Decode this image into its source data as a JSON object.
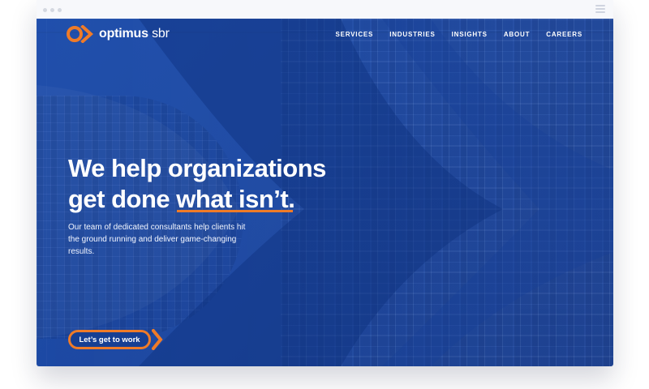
{
  "browser": {
    "menu_icon": "hamburger-menu-icon",
    "window_dots_icon": "window-dots-icon"
  },
  "brand": {
    "name_bold": "optimus",
    "name_regular": " sbr",
    "logo_icon": "optimus-logo-icon",
    "accent_color": "#ef7b28"
  },
  "nav": {
    "items": [
      {
        "label": "SERVICES"
      },
      {
        "label": "INDUSTRIES"
      },
      {
        "label": "INSIGHTS"
      },
      {
        "label": "ABOUT"
      },
      {
        "label": "CAREERS"
      }
    ]
  },
  "hero": {
    "headline_line_1": "We help organizations",
    "headline_line_2_prefix": "get done ",
    "headline_highlight": "what isn’t.",
    "description": "Our team of dedicated consultants help clients hit the ground running and deliver game-changing results.",
    "cta_label": "Let’s get to work",
    "cta_arrow_icon": "chevron-right-icon"
  },
  "colors": {
    "hero_blue": "#1a46a1",
    "text_white": "#ffffff",
    "accent_orange": "#ef7b28"
  }
}
